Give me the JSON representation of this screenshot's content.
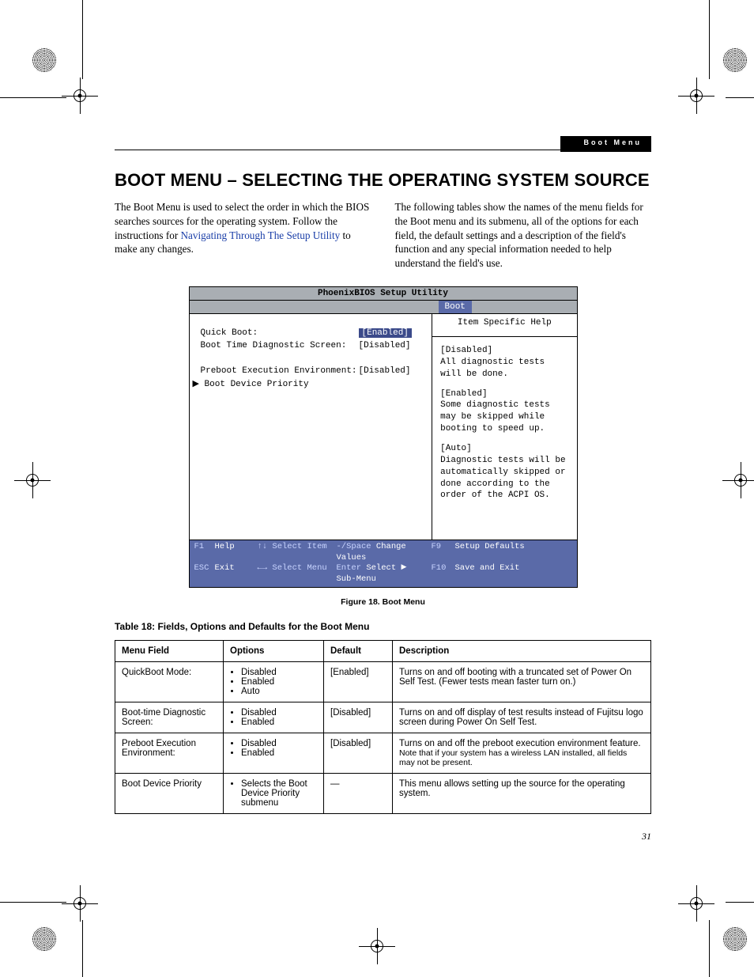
{
  "header": {
    "tab": "Boot Menu"
  },
  "title": "BOOT MENU – SELECTING THE OPERATING SYSTEM SOURCE",
  "para": {
    "p1a": "The Boot Menu is used to select the order in which the BIOS searches sources for the operating system. Follow the instructions for ",
    "p1link": "Navigating Through The Setup Utility",
    "p1b": " to make any changes.",
    "p2": "The following tables show the names of the menu fields for the Boot menu and its submenu, all of the options for each field, the default settings and a description of the field's function and any special information needed to help understand the field's use."
  },
  "bios": {
    "title": "PhoenixBIOS Setup Utility",
    "active_tab": "Boot",
    "rows": [
      {
        "label": "Quick Boot:",
        "value": "[Enabled]",
        "selected": true
      },
      {
        "label": "Boot Time Diagnostic Screen:",
        "value": "[Disabled]",
        "selected": false
      },
      {
        "label": "",
        "value": "",
        "selected": false
      },
      {
        "label": "Preboot Execution Environment:",
        "value": "[Disabled]",
        "selected": false
      },
      {
        "label": "▶ Boot Device Priority",
        "value": "",
        "selected": false
      }
    ],
    "help_title": "Item Specific Help",
    "help": {
      "p1": "[Disabled]\nAll diagnostic tests will be done.",
      "p2": "[Enabled]\nSome diagnostic tests may be skipped while booting to speed up.",
      "p3": "[Auto]\nDiagnostic tests will be automatically skipped or done according to the order of the ACPI OS."
    },
    "foot": {
      "r1": {
        "k1": "F1",
        "l1": "Help",
        "a1": "↑↓ Select Item",
        "m1": "-/Space Change Values",
        "k2": "F9",
        "l2": "Setup Defaults"
      },
      "r2": {
        "k1": "ESC",
        "l1": "Exit",
        "a1": "←→ Select Menu",
        "m1": "Enter Select ▶ Sub-Menu",
        "k2": "F10",
        "l2": "Save and Exit"
      }
    }
  },
  "fig_caption": "Figure 18.  Boot Menu",
  "table_caption": "Table 18: Fields, Options and Defaults for the Boot Menu",
  "table": {
    "head": {
      "c1": "Menu Field",
      "c2": "Options",
      "c3": "Default",
      "c4": "Description"
    },
    "rows": [
      {
        "field": "QuickBoot Mode:",
        "opts": [
          "Disabled",
          "Enabled",
          "Auto"
        ],
        "def": "[Enabled]",
        "desc": "Turns on and off booting with a truncated set of Power On Self Test. (Fewer tests mean faster turn on.)"
      },
      {
        "field": "Boot-time Diagnostic Screen:",
        "opts": [
          "Disabled",
          "Enabled"
        ],
        "def": "[Disabled]",
        "desc": "Turns on and off display of test results instead of Fujitsu logo screen during Power On Self Test."
      },
      {
        "field": "Preboot Execution Environment:",
        "opts": [
          "Disabled",
          "Enabled"
        ],
        "def": "[Disabled]",
        "desc": "Turns on and off the preboot execution environment feature.",
        "note": "Note that if your system has a wireless LAN installed, all fields may not be present."
      },
      {
        "field": "Boot Device Priority",
        "opts": [
          "Selects the Boot Device Priority submenu"
        ],
        "def": "—",
        "desc": "This menu allows setting up the source for the operating system."
      }
    ]
  },
  "page_number": "31"
}
